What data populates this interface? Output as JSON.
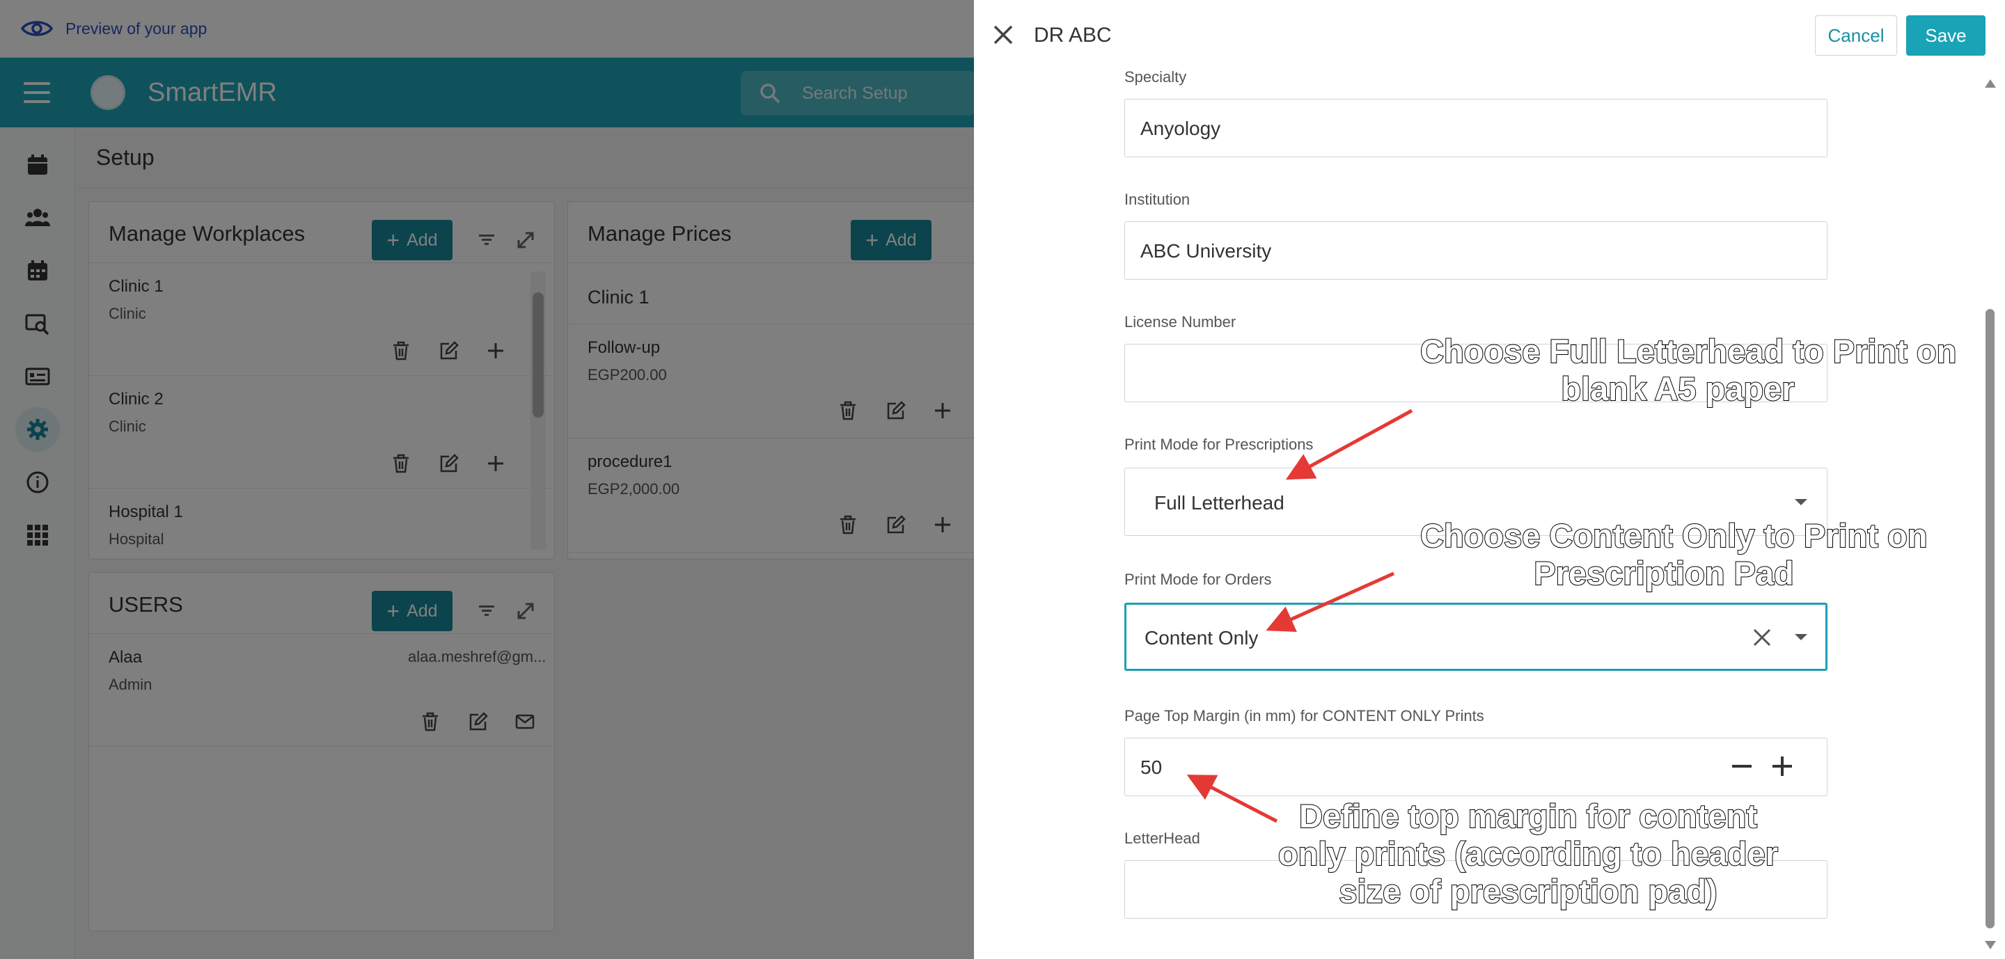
{
  "preview_bar": {
    "text": "Preview of your app"
  },
  "app": {
    "brand": "SmartEMR",
    "search_placeholder": "Search Setup"
  },
  "setup": {
    "title": "Setup"
  },
  "workplaces": {
    "title": "Manage Workplaces",
    "add_label": "Add",
    "items": [
      {
        "name": "Clinic 1",
        "type": "Clinic"
      },
      {
        "name": "Clinic 2",
        "type": "Clinic"
      },
      {
        "name": "Hospital 1",
        "type": "Hospital"
      }
    ]
  },
  "prices": {
    "title": "Manage Prices",
    "add_label": "Add",
    "group": "Clinic 1",
    "items": [
      {
        "name": "Follow-up",
        "price": "EGP200.00"
      },
      {
        "name": "procedure1",
        "price": "EGP2,000.00"
      }
    ]
  },
  "users": {
    "title": "USERS",
    "add_label": "Add",
    "items": [
      {
        "name": "Alaa",
        "role": "Admin",
        "email": "alaa.meshref@gm..."
      }
    ]
  },
  "dialog": {
    "title": "DR ABC",
    "cancel_label": "Cancel",
    "save_label": "Save",
    "fields": {
      "specialty": {
        "label": "Specialty",
        "value": "Anyology"
      },
      "institution": {
        "label": "Institution",
        "value": "ABC University"
      },
      "license": {
        "label": "License Number",
        "value": ""
      },
      "print_rx": {
        "label": "Print Mode for Prescriptions",
        "value": "Full Letterhead"
      },
      "print_orders": {
        "label": "Print Mode for Orders",
        "value": "Content Only"
      },
      "top_margin": {
        "label": "Page Top Margin (in mm) for CONTENT ONLY Prints",
        "value": "50"
      },
      "letterhead": {
        "label": "LetterHead",
        "value": ""
      }
    }
  },
  "annotations": {
    "a1_line1": "Choose Full Letterhead to Print on",
    "a1_line2": "blank A5 paper",
    "a2_line1": "Choose Content Only to Print on",
    "a2_line2": "Prescription Pad",
    "a3_line1": "Define top margin for content",
    "a3_line2": "only prints (according to header",
    "a3_line3": "size of prescription pad)"
  },
  "colors": {
    "accent": "#1ea4b6",
    "button": "#17889b",
    "arrow": "#e53935",
    "link": "#2c4fbf"
  }
}
